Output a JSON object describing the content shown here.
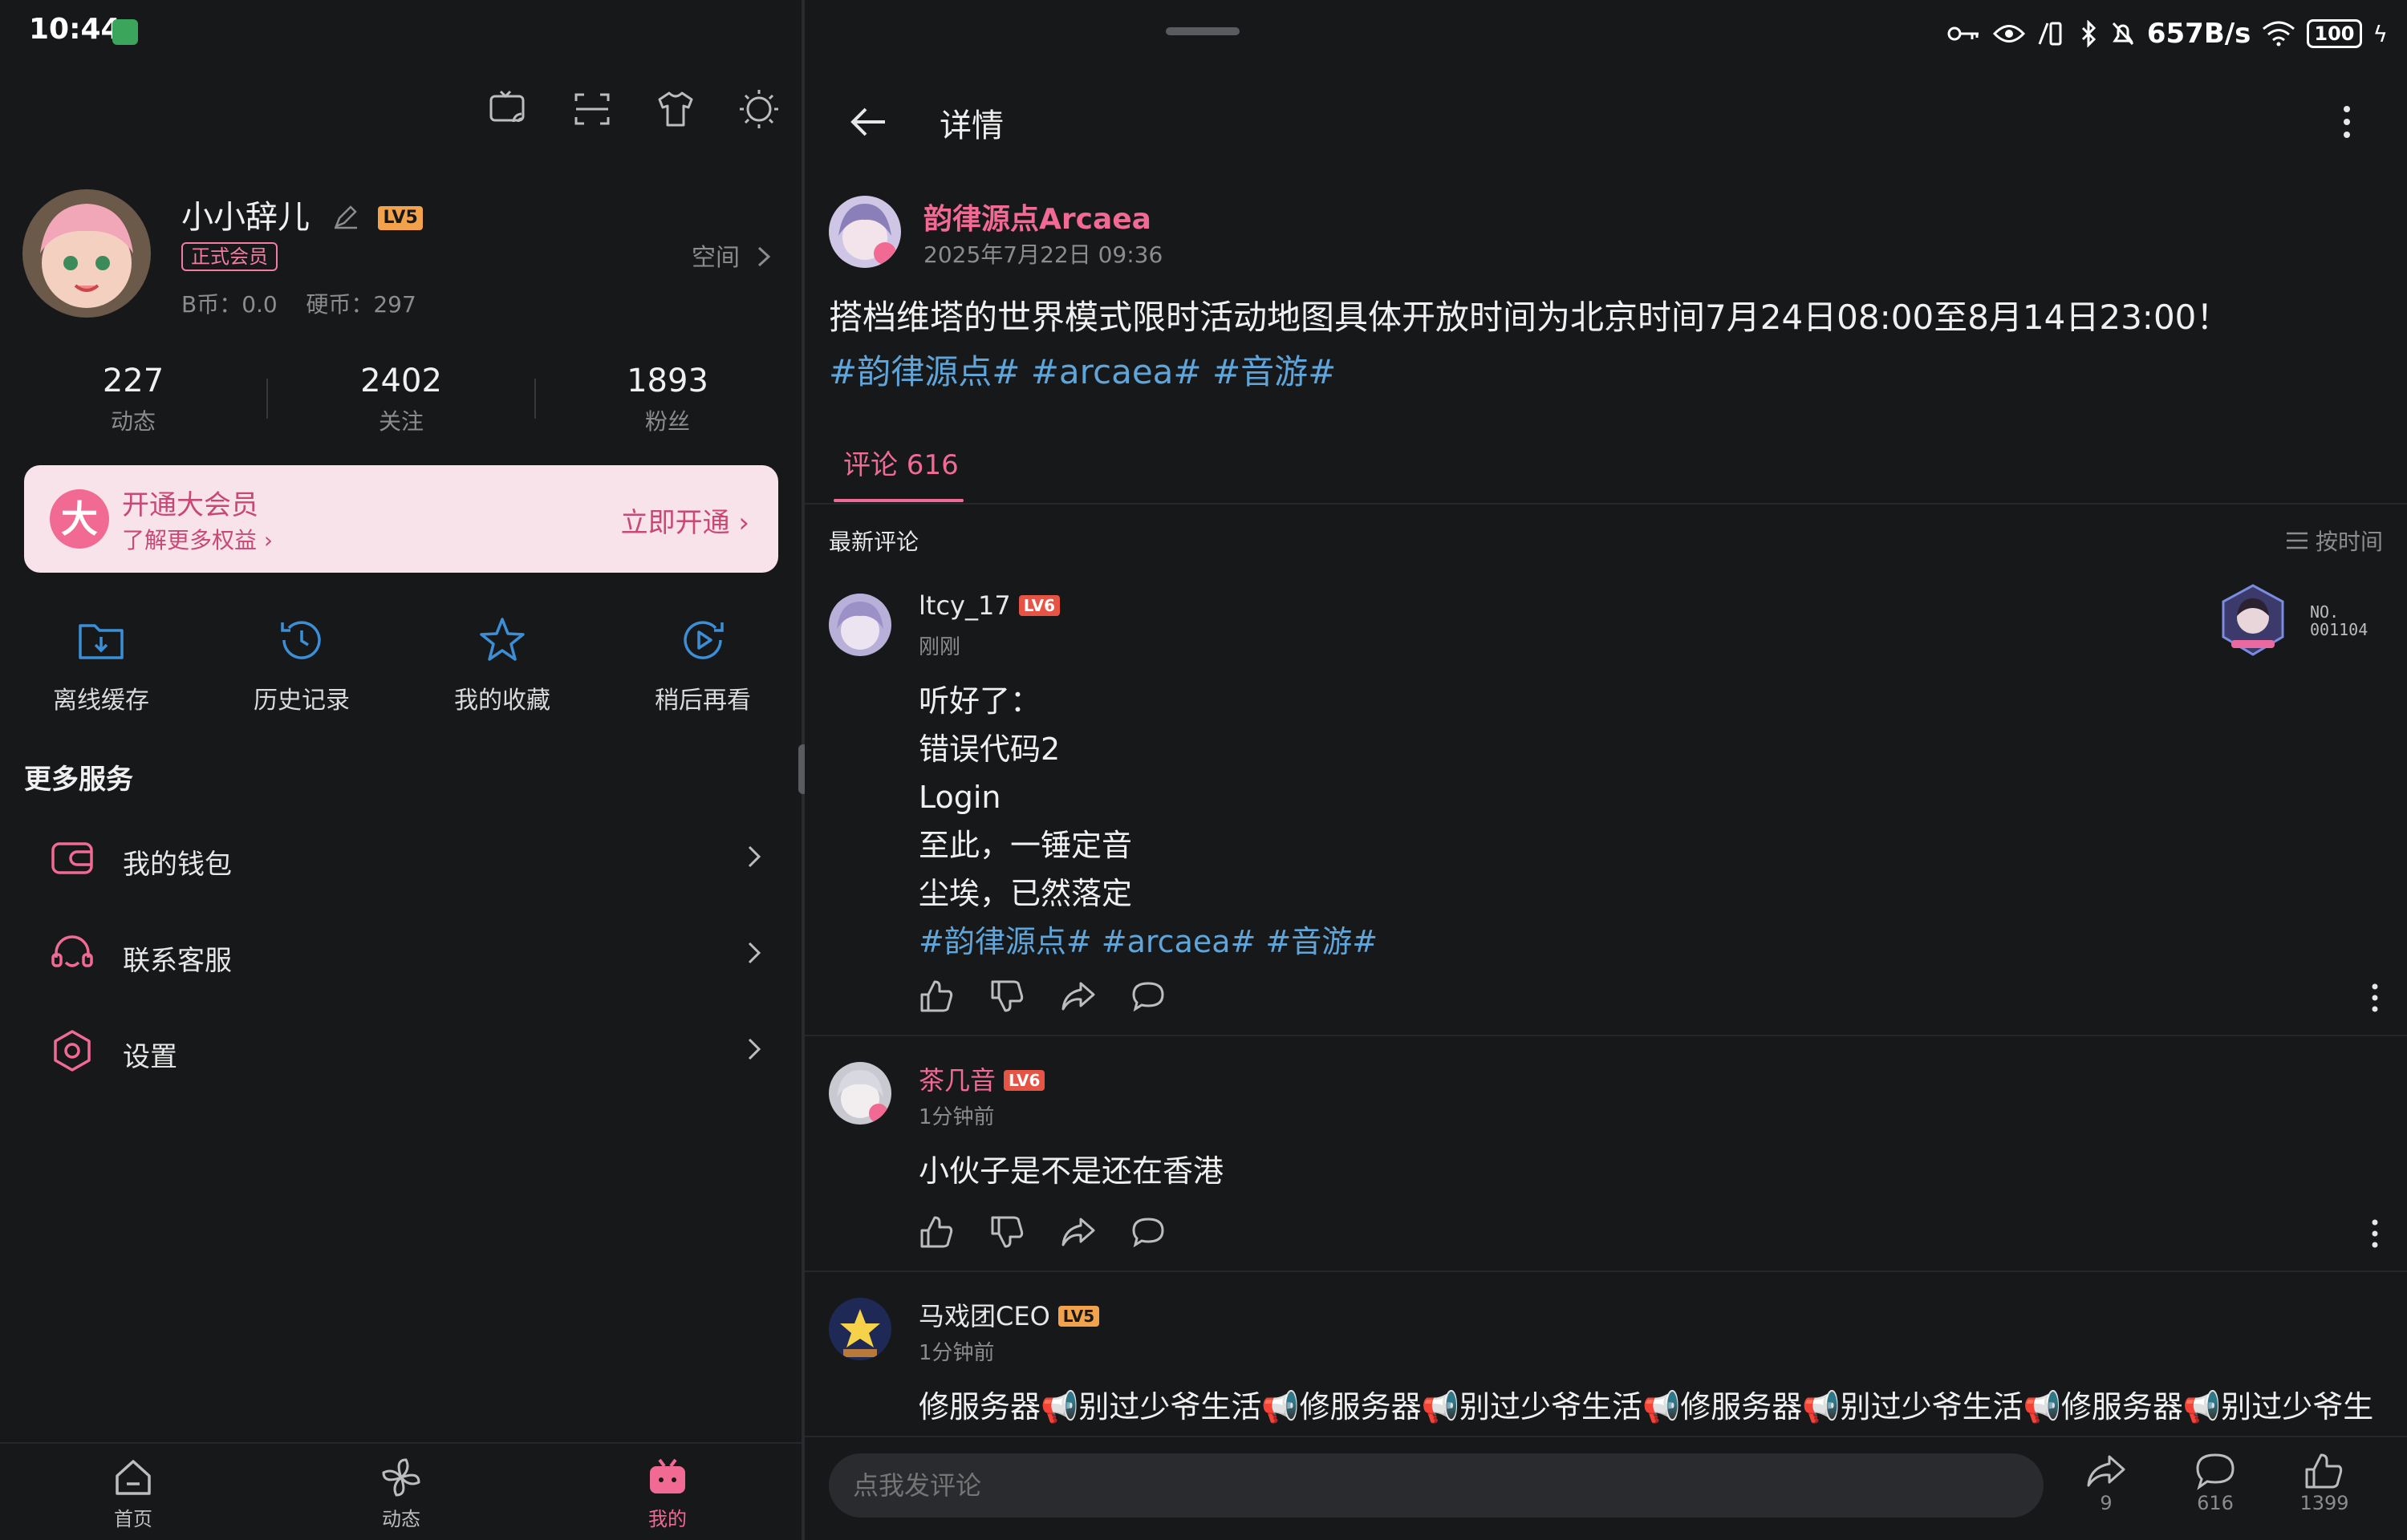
{
  "status": {
    "time": "10:44",
    "network_speed": "657B/s",
    "battery": "100"
  },
  "profile": {
    "username": "小小辞儿",
    "level": "LV5",
    "member_tag": "正式会员",
    "coins_text": "B币：0.0    硬币：297",
    "space_link": "空间",
    "stats": [
      {
        "value": "227",
        "label": "动态"
      },
      {
        "value": "2402",
        "label": "关注"
      },
      {
        "value": "1893",
        "label": "粉丝"
      }
    ]
  },
  "vip": {
    "icon_text": "大",
    "title": "开通大会员",
    "subtitle": "了解更多权益",
    "cta": "立即开通"
  },
  "quick_actions": [
    {
      "label": "离线缓存",
      "icon": "download-folder-icon"
    },
    {
      "label": "历史记录",
      "icon": "history-icon"
    },
    {
      "label": "我的收藏",
      "icon": "star-icon"
    },
    {
      "label": "稍后再看",
      "icon": "watch-later-icon"
    }
  ],
  "services": {
    "title": "更多服务",
    "items": [
      {
        "label": "我的钱包",
        "icon": "wallet-icon"
      },
      {
        "label": "联系客服",
        "icon": "headset-icon"
      },
      {
        "label": "设置",
        "icon": "settings-icon"
      }
    ]
  },
  "bottom_nav": [
    {
      "label": "首页",
      "icon": "home-icon"
    },
    {
      "label": "动态",
      "icon": "pinwheel-icon"
    },
    {
      "label": "我的",
      "icon": "tv-icon"
    }
  ],
  "detail": {
    "title": "详情",
    "poster": {
      "name": "韵律源点Arcaea",
      "time": "2025年7月22日 09:36"
    },
    "post_text": "搭档维塔的世界模式限时活动地图具体开放时间为北京时间7月24日08:00至8月14日23:00！",
    "post_tags": "#韵律源点# #arcaea# #音游#",
    "tab_label": "评论 616",
    "sort_left": "最新评论",
    "sort_right": "按时间",
    "comments": [
      {
        "name": "ltcy_17",
        "level": "LV6",
        "time": "刚刚",
        "lines": [
          "听好了：",
          "错误代码2",
          "Login",
          "至此，一锤定音",
          "尘埃，已然落定"
        ],
        "tags": "#韵律源点# #arcaea# #音游#",
        "badge_text": "NO.\n001104"
      },
      {
        "name": "茶几音",
        "level": "LV6",
        "time": "1分钟前",
        "lines": [
          "小伙子是不是还在香港"
        ]
      },
      {
        "name": "马戏团CEO",
        "level": "LV5",
        "time": "1分钟前",
        "lines": [
          "修服务器📢别过少爷生活📢修服务器📢别过少爷生活📢修服务器📢别过少爷生活📢修服务器📢别过少爷生"
        ]
      }
    ],
    "compose_placeholder": "点我发评论",
    "counts": {
      "share": "9",
      "comment": "616",
      "like": "1399"
    }
  },
  "colors": {
    "background": "#17181A",
    "accent_pink": "#F06A94",
    "tag_blue": "#5FA5D9",
    "icon_blue": "#3C8FD6"
  }
}
